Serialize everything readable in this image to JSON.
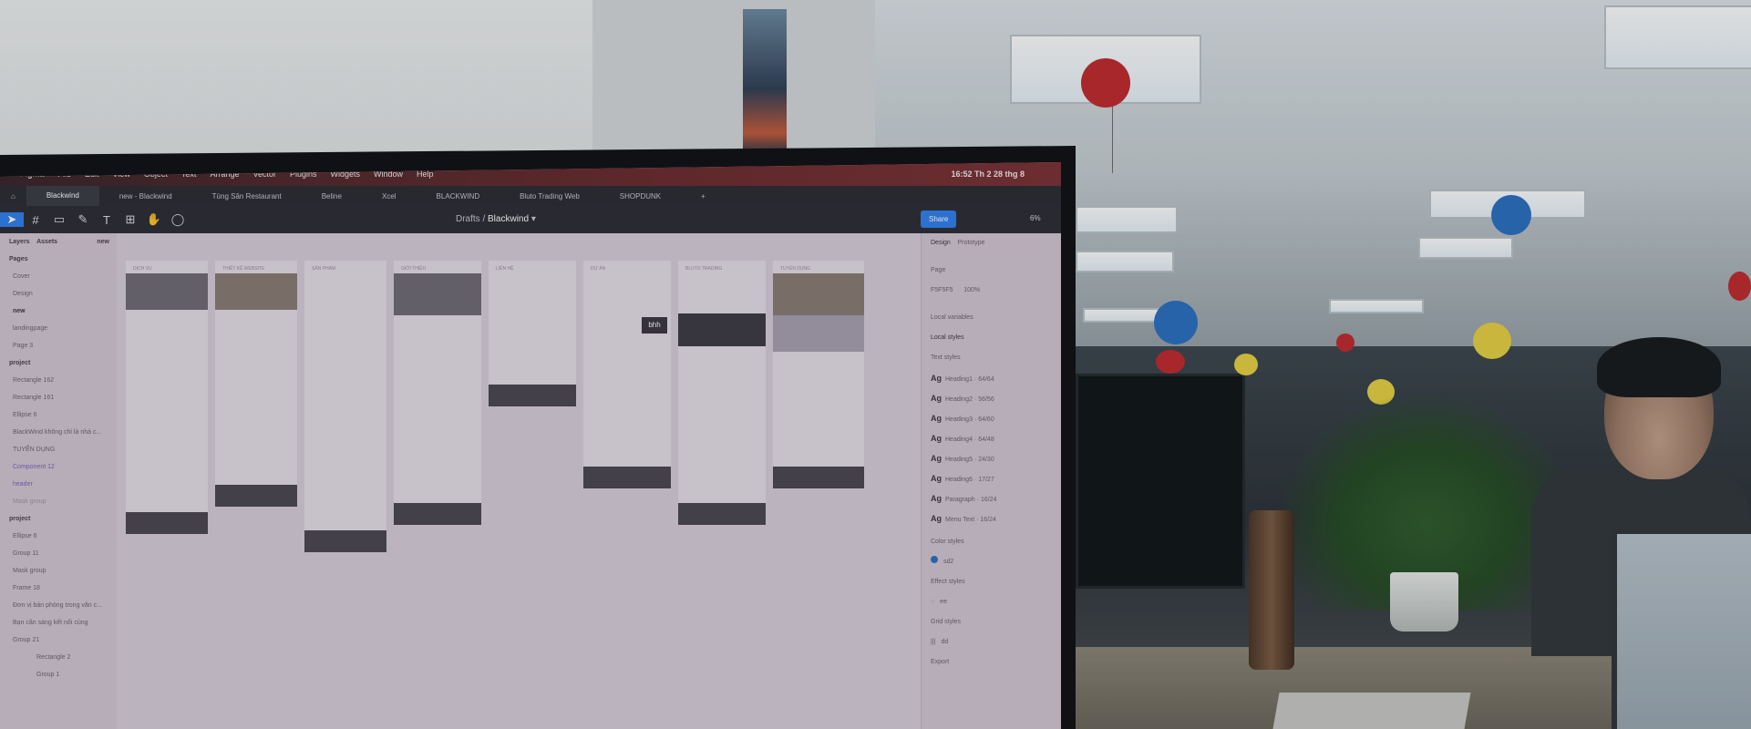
{
  "figma": {
    "menu": [
      "Figma",
      "File",
      "Edit",
      "View",
      "Object",
      "Text",
      "Arrange",
      "Vector",
      "Plugins",
      "Widgets",
      "Window",
      "Help"
    ],
    "clock": "16:52  Th 2 28 thg 8",
    "tabs": [
      "Blackwind",
      "new - Blackwind",
      "Tùng Sân Restaurant",
      "Beline",
      "Xcel",
      "BLACKWIND",
      "Bluto Trading Web",
      "SHOPDUNK"
    ],
    "breadcrumb": {
      "parent": "Drafts",
      "current": "Blackwind"
    },
    "share_label": "Share",
    "zoom": "6%",
    "left_panel": {
      "tabs": [
        "Layers",
        "Assets"
      ],
      "page_badge": "new",
      "pages_header": "Pages",
      "pages": [
        "Cover",
        "Design",
        "new",
        "landingpage",
        "Page 3"
      ],
      "layers_group_1": "project",
      "layers_1": [
        "Rectangle 162",
        "Rectangle 161",
        "Ellipse 6",
        "BlackWind không chỉ là nhà c...",
        "TUYỂN DỤNG",
        "Component 12",
        "header",
        "Mask group"
      ],
      "layers_group_2": "project",
      "layers_2": [
        "Ellipse 6",
        "Group 11",
        "Mask group",
        "Frame 18",
        "Đơn vị bán phòng trong văn c...",
        "Bạn cần sáng kết nối cùng",
        "Group 21",
        "Rectangle 2",
        "Group 1"
      ]
    },
    "right_panel": {
      "tabs": [
        "Design",
        "Prototype"
      ],
      "page_label": "Page",
      "page_color": "F5F5F5",
      "page_opacity": "100%",
      "local_variables": "Local variables",
      "local_styles": "Local styles",
      "text_styles_label": "Text styles",
      "text_styles": [
        {
          "name": "Heading1",
          "spec": "64/64"
        },
        {
          "name": "Heading2",
          "spec": "56/56"
        },
        {
          "name": "Heading3",
          "spec": "64/60"
        },
        {
          "name": "Heading4",
          "spec": "64/48"
        },
        {
          "name": "Heading5",
          "spec": "24/30"
        },
        {
          "name": "Heading6",
          "spec": "17/27"
        },
        {
          "name": "Paragraph",
          "spec": "16/24"
        },
        {
          "name": "Menu Text",
          "spec": "16/24"
        }
      ],
      "color_styles_label": "Color styles",
      "color_style": "sd2",
      "effect_styles_label": "Effect styles",
      "effect_style": "ee",
      "grid_styles_label": "Grid styles",
      "grid_style": "dd",
      "export_label": "Export"
    },
    "frames": [
      "DỊCH VỤ",
      "THIẾT KẾ WEBSITE",
      "SẢN PHẨM",
      "GIỚI THIỆU",
      "LIÊN HỆ",
      "DỰ ÁN",
      "BLUTO TRADING",
      "TUYỂN DỤNG"
    ],
    "frame_logo": "bhh"
  },
  "colors": {
    "menubar": "#6a2a2c",
    "share": "#2f7ff0",
    "panel": "#d3c6d2",
    "canvas": "#d8cdd8",
    "lantern_red": "#c0282c",
    "lantern_blue": "#2a6fc0",
    "lantern_yellow": "#e8d040"
  }
}
